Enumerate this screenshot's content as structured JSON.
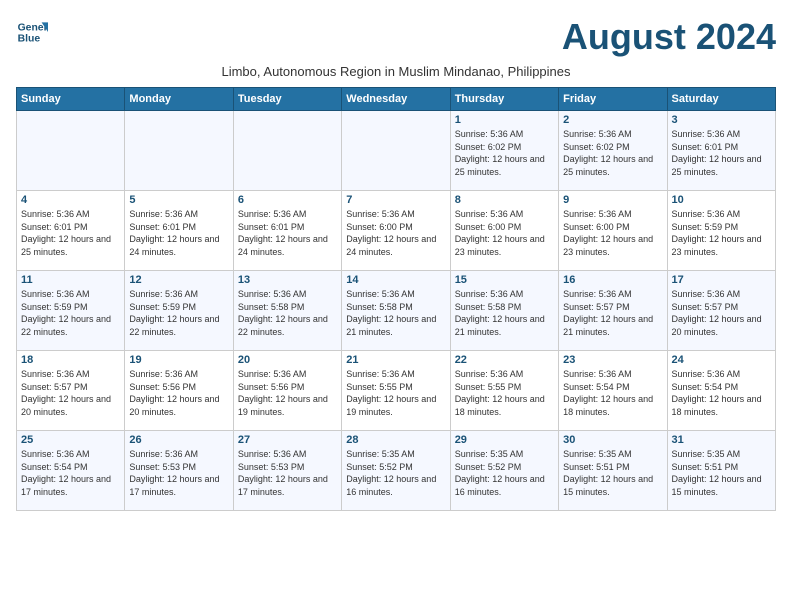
{
  "logo": {
    "line1": "General",
    "line2": "Blue"
  },
  "title": "August 2024",
  "subtitle": "Limbo, Autonomous Region in Muslim Mindanao, Philippines",
  "weekdays": [
    "Sunday",
    "Monday",
    "Tuesday",
    "Wednesday",
    "Thursday",
    "Friday",
    "Saturday"
  ],
  "weeks": [
    [
      {
        "day": "",
        "info": ""
      },
      {
        "day": "",
        "info": ""
      },
      {
        "day": "",
        "info": ""
      },
      {
        "day": "",
        "info": ""
      },
      {
        "day": "1",
        "info": "Sunrise: 5:36 AM\nSunset: 6:02 PM\nDaylight: 12 hours and 25 minutes."
      },
      {
        "day": "2",
        "info": "Sunrise: 5:36 AM\nSunset: 6:02 PM\nDaylight: 12 hours and 25 minutes."
      },
      {
        "day": "3",
        "info": "Sunrise: 5:36 AM\nSunset: 6:01 PM\nDaylight: 12 hours and 25 minutes."
      }
    ],
    [
      {
        "day": "4",
        "info": "Sunrise: 5:36 AM\nSunset: 6:01 PM\nDaylight: 12 hours and 25 minutes."
      },
      {
        "day": "5",
        "info": "Sunrise: 5:36 AM\nSunset: 6:01 PM\nDaylight: 12 hours and 24 minutes."
      },
      {
        "day": "6",
        "info": "Sunrise: 5:36 AM\nSunset: 6:01 PM\nDaylight: 12 hours and 24 minutes."
      },
      {
        "day": "7",
        "info": "Sunrise: 5:36 AM\nSunset: 6:00 PM\nDaylight: 12 hours and 24 minutes."
      },
      {
        "day": "8",
        "info": "Sunrise: 5:36 AM\nSunset: 6:00 PM\nDaylight: 12 hours and 23 minutes."
      },
      {
        "day": "9",
        "info": "Sunrise: 5:36 AM\nSunset: 6:00 PM\nDaylight: 12 hours and 23 minutes."
      },
      {
        "day": "10",
        "info": "Sunrise: 5:36 AM\nSunset: 5:59 PM\nDaylight: 12 hours and 23 minutes."
      }
    ],
    [
      {
        "day": "11",
        "info": "Sunrise: 5:36 AM\nSunset: 5:59 PM\nDaylight: 12 hours and 22 minutes."
      },
      {
        "day": "12",
        "info": "Sunrise: 5:36 AM\nSunset: 5:59 PM\nDaylight: 12 hours and 22 minutes."
      },
      {
        "day": "13",
        "info": "Sunrise: 5:36 AM\nSunset: 5:58 PM\nDaylight: 12 hours and 22 minutes."
      },
      {
        "day": "14",
        "info": "Sunrise: 5:36 AM\nSunset: 5:58 PM\nDaylight: 12 hours and 21 minutes."
      },
      {
        "day": "15",
        "info": "Sunrise: 5:36 AM\nSunset: 5:58 PM\nDaylight: 12 hours and 21 minutes."
      },
      {
        "day": "16",
        "info": "Sunrise: 5:36 AM\nSunset: 5:57 PM\nDaylight: 12 hours and 21 minutes."
      },
      {
        "day": "17",
        "info": "Sunrise: 5:36 AM\nSunset: 5:57 PM\nDaylight: 12 hours and 20 minutes."
      }
    ],
    [
      {
        "day": "18",
        "info": "Sunrise: 5:36 AM\nSunset: 5:57 PM\nDaylight: 12 hours and 20 minutes."
      },
      {
        "day": "19",
        "info": "Sunrise: 5:36 AM\nSunset: 5:56 PM\nDaylight: 12 hours and 20 minutes."
      },
      {
        "day": "20",
        "info": "Sunrise: 5:36 AM\nSunset: 5:56 PM\nDaylight: 12 hours and 19 minutes."
      },
      {
        "day": "21",
        "info": "Sunrise: 5:36 AM\nSunset: 5:55 PM\nDaylight: 12 hours and 19 minutes."
      },
      {
        "day": "22",
        "info": "Sunrise: 5:36 AM\nSunset: 5:55 PM\nDaylight: 12 hours and 18 minutes."
      },
      {
        "day": "23",
        "info": "Sunrise: 5:36 AM\nSunset: 5:54 PM\nDaylight: 12 hours and 18 minutes."
      },
      {
        "day": "24",
        "info": "Sunrise: 5:36 AM\nSunset: 5:54 PM\nDaylight: 12 hours and 18 minutes."
      }
    ],
    [
      {
        "day": "25",
        "info": "Sunrise: 5:36 AM\nSunset: 5:54 PM\nDaylight: 12 hours and 17 minutes."
      },
      {
        "day": "26",
        "info": "Sunrise: 5:36 AM\nSunset: 5:53 PM\nDaylight: 12 hours and 17 minutes."
      },
      {
        "day": "27",
        "info": "Sunrise: 5:36 AM\nSunset: 5:53 PM\nDaylight: 12 hours and 17 minutes."
      },
      {
        "day": "28",
        "info": "Sunrise: 5:35 AM\nSunset: 5:52 PM\nDaylight: 12 hours and 16 minutes."
      },
      {
        "day": "29",
        "info": "Sunrise: 5:35 AM\nSunset: 5:52 PM\nDaylight: 12 hours and 16 minutes."
      },
      {
        "day": "30",
        "info": "Sunrise: 5:35 AM\nSunset: 5:51 PM\nDaylight: 12 hours and 15 minutes."
      },
      {
        "day": "31",
        "info": "Sunrise: 5:35 AM\nSunset: 5:51 PM\nDaylight: 12 hours and 15 minutes."
      }
    ]
  ]
}
